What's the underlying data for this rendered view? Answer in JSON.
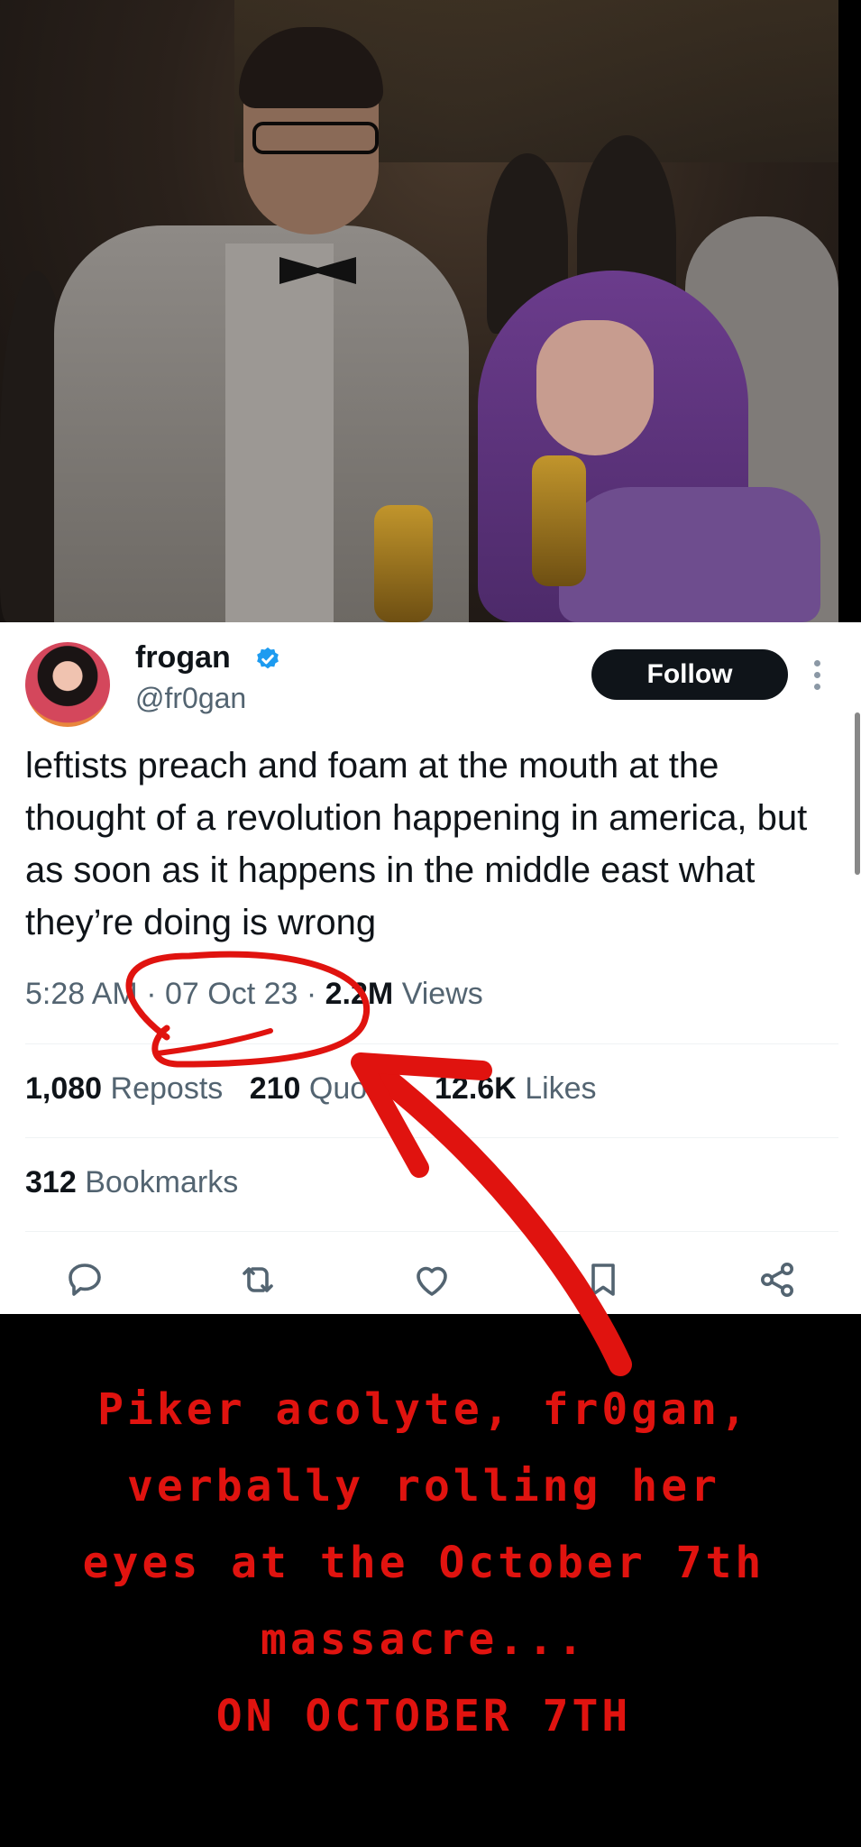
{
  "tweet": {
    "author": {
      "display_name": "frogan",
      "handle": "@fr0gan",
      "verified": true
    },
    "follow_label": "Follow",
    "text": "leftists preach and foam at the mouth at the thought of a revolution happening in america, but as soon as it happens in the middle east what they’re doing is wrong",
    "time": "5:28 AM",
    "separator": "·",
    "date": "07 Oct 23",
    "views_count": "2.2M",
    "views_label": "Views",
    "stats": [
      {
        "count": "1,080",
        "label": "Reposts"
      },
      {
        "count": "210",
        "label": "Quotes"
      },
      {
        "count": "12.6K",
        "label": "Likes"
      }
    ],
    "bookmarks": {
      "count": "312",
      "label": "Bookmarks"
    },
    "actions": [
      "reply-icon",
      "repost-icon",
      "like-icon",
      "bookmark-icon",
      "share-icon"
    ]
  },
  "caption": {
    "lines": [
      "Piker acolyte, fr0gan,",
      "verbally rolling her",
      "eyes at the October 7th",
      "massacre...",
      "ON OCTOBER 7TH"
    ]
  },
  "colors": {
    "annotation_red": "#e0130f",
    "verified_blue": "#1d9bf0",
    "text_primary": "#0f1419",
    "text_secondary": "#536471"
  }
}
